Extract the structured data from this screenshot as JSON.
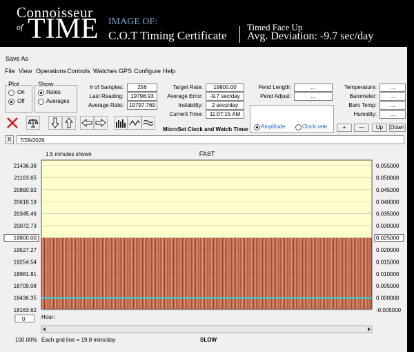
{
  "banner": {
    "logo_line1": "Connoisseur",
    "logo_of": "of",
    "logo_line2": "TIME",
    "image_of": "IMAGE OF:",
    "title": "C.O.T Timing Certificate",
    "position": "Timed Face Up",
    "avg_deviation": "Avg. Deviation: -9.7 sec/day",
    "colors": {
      "accent": "#7aa6d6"
    }
  },
  "window": {
    "title": "Save As"
  },
  "menu": [
    "File",
    "View",
    "Operations",
    "Controls",
    "Watches",
    "GPS",
    "Configure",
    "Help"
  ],
  "plot": {
    "label": "Plot",
    "options": [
      "On",
      "Off"
    ],
    "selected": "Off"
  },
  "show": {
    "label": "Show",
    "options": [
      "Rates",
      "Averages"
    ],
    "selected": "Rates"
  },
  "stats": {
    "samples_label": "# of Samples:",
    "samples": "256",
    "last_label": "Last Reading:",
    "last": "19798.93",
    "avg_label": "Average Rate:",
    "avg": "19797.769"
  },
  "target": {
    "target_label": "Target Rate:",
    "target": "19800.00",
    "error_label": "Average Error:",
    "error": "-9.7 sec/day",
    "instab_label": "Instability:",
    "instab": "2 secs/day",
    "time_label": "Current Time:",
    "time": "11:07:15 AM"
  },
  "pendulum": {
    "length_label": "Pend Length:",
    "length": "...",
    "adjust_label": "Pend Adjust:",
    "adjust": "...",
    "mode_options": [
      "Amplitude",
      "Clock rate"
    ],
    "mode_selected": "Amplitude"
  },
  "environment": {
    "temp_label": "Temperature:",
    "temp": "...",
    "baro_label": "Barometer:",
    "baro": "...",
    "barotemp_label": "Baro Temp:",
    "barotemp": "...",
    "humid_label": "Humidity:",
    "humid": "..."
  },
  "step_buttons": [
    "+",
    "—",
    "Up",
    "Down"
  ],
  "microset_label": "MicroSet Clock and Watch Timer",
  "date": "7/29/2026",
  "date_clear": "X",
  "toolbar_icons": [
    "close-icon",
    "scale-icon",
    "arrow-down-icon",
    "arrow-up-icon",
    "arrow-left-icon",
    "arrow-right-icon",
    "bar-chart-icon",
    "wave-icon",
    "waves-icon"
  ],
  "chart_data": {
    "type": "bar",
    "title": "FAST",
    "top_left_note": "1.5 minutes shown",
    "bottom_label": "SLOW",
    "x_label": "Hour:",
    "x_start": "0",
    "left_ticks": [
      "21436.38",
      "21163.65",
      "20890.92",
      "20618.19",
      "20345.46",
      "20072.73",
      "19800.00",
      "19527.27",
      "19254.54",
      "18981.81",
      "18709.08",
      "18436.35",
      "18163.62"
    ],
    "right_ticks": [
      "0.055000",
      "0.050000",
      "0.045000",
      "0.040000",
      "0.035000",
      "0.030000",
      "0.025000",
      "0.020000",
      "0.015000",
      "0.010000",
      "0.005000",
      "0.000000",
      "-0.005000"
    ],
    "ylim": [
      18163.62,
      21436.38
    ],
    "right_ylim": [
      -0.005,
      0.055
    ],
    "target_rate": 19800.0,
    "sample_count": 256,
    "values": [],
    "series": [
      {
        "values": [],
        "color": "#a83a26"
      },
      {
        "values": [],
        "color": "#40c8d8"
      }
    ],
    "bar_rate": 19797.769,
    "line_level": 0.0,
    "colors": {
      "bg": "#ffffcc",
      "bars": "#a83a26",
      "line": "#40c8d8"
    }
  },
  "status": {
    "zoom": "100.00%",
    "grid_note": "Each grid line = 19.8 mins/day",
    "slow": "SLOW"
  }
}
